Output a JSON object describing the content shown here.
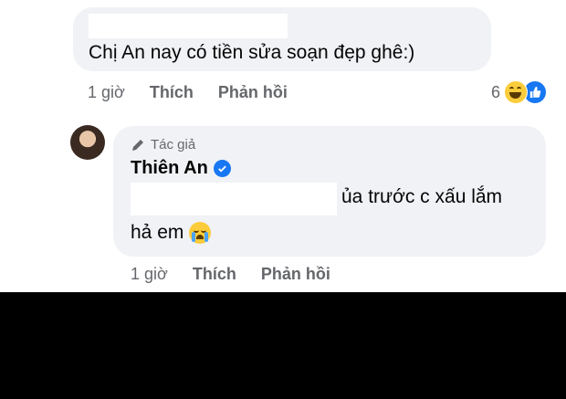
{
  "comment1": {
    "text": "Chị An nay có tiền sửa soạn đẹp ghê:)",
    "time": "1 giờ",
    "like_label": "Thích",
    "reply_label": "Phản hồi",
    "reaction_count": "6",
    "reaction_icons": [
      "haha-icon",
      "like-icon"
    ]
  },
  "comment2": {
    "author_badge": "Tác giả",
    "author_name": "Thiên An",
    "text_line1": "ủa trước c xấu lắm",
    "text_line2": "hả em",
    "time": "1 giờ",
    "like_label": "Thích",
    "reply_label": "Phản hồi",
    "emoji": "crying-face-icon"
  },
  "colors": {
    "bubble": "#f0f2f5",
    "meta_text": "#65676b",
    "facebook_blue": "#1877f2"
  }
}
